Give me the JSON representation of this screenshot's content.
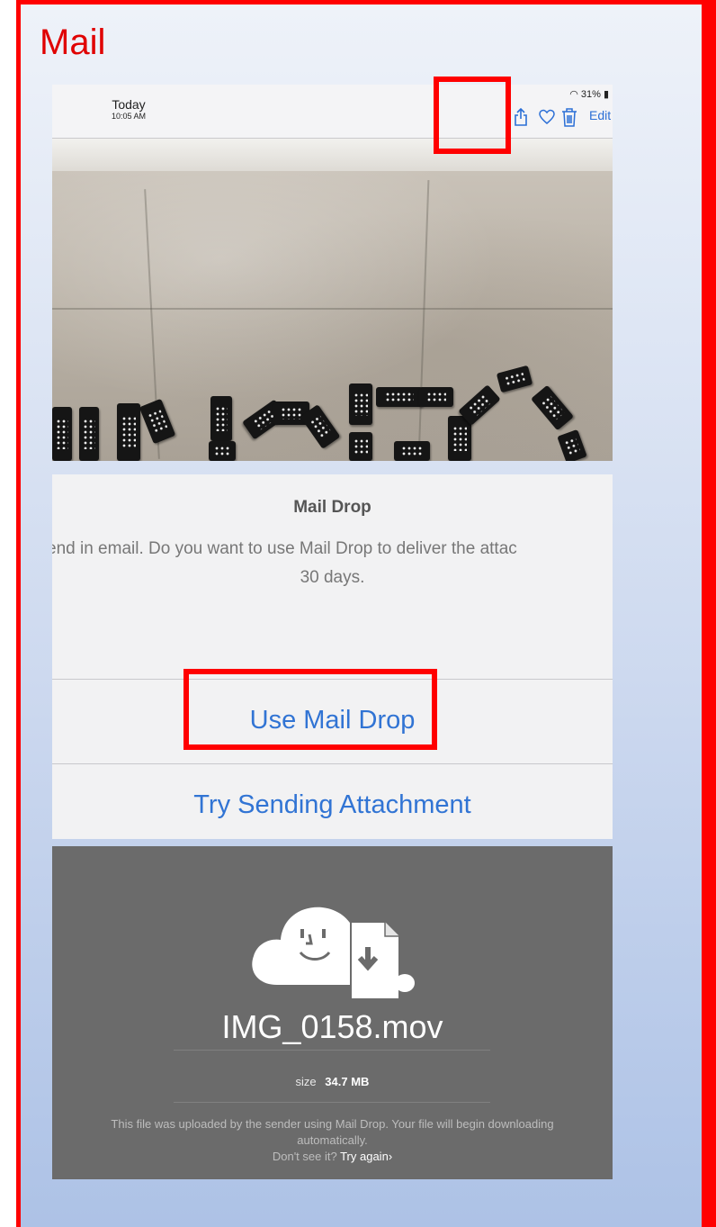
{
  "slide": {
    "title": "Mail",
    "accent_color": "#ff0000"
  },
  "ipad_bar": {
    "status": "31%",
    "date": "Today",
    "time": "10:05 AM",
    "icons": [
      "share-icon",
      "heart-icon",
      "trash-icon"
    ],
    "edit_label": "Edit"
  },
  "dialog": {
    "title": "Mail Drop",
    "message_line1": "end in email. Do you want to use Mail Drop to deliver the attac",
    "message_line2": "30 days.",
    "use_mail_drop_label": "Use Mail Drop",
    "try_sending_label": "Try Sending Attachment",
    "button_color": "#3174d4"
  },
  "download": {
    "file_name": "IMG_0158.mov",
    "size_label": "size",
    "size_value": "34.7 MB",
    "note_line1": "This file was uploaded by the sender using Mail Drop. Your file will begin downloading",
    "note_line2": "automatically.",
    "retry_prompt": "Don't see it?",
    "retry_link": "Try again",
    "retry_chevron": "›"
  }
}
